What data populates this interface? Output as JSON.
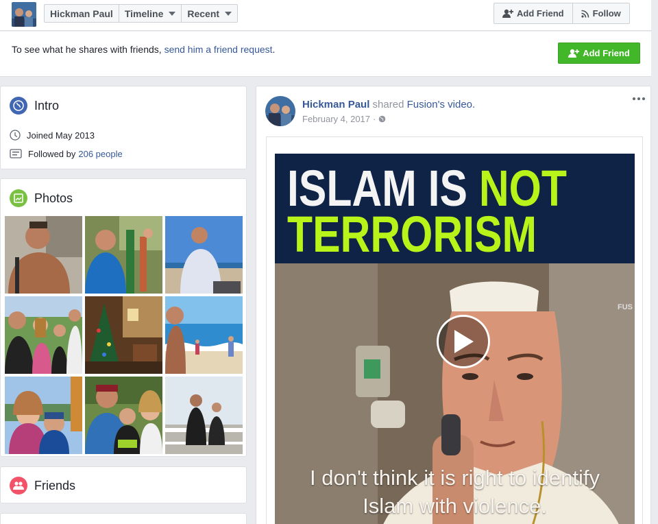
{
  "header": {
    "profile_name": "Hickman Paul",
    "nav_timeline": "Timeline",
    "nav_recent": "Recent",
    "add_friend": "Add Friend",
    "follow": "Follow"
  },
  "request_bar": {
    "text": "To see what he shares with friends,",
    "link": "send him a friend request",
    "link_suffix": ".",
    "button": "Add Friend"
  },
  "intro": {
    "title": "Intro",
    "joined": "Joined May 2013",
    "followed_prefix": "Followed by",
    "followed_count": "206 people"
  },
  "photos": {
    "title": "Photos"
  },
  "friends": {
    "title": "Friends"
  },
  "post": {
    "author": "Hickman Paul",
    "action": "shared",
    "page": "Fusion",
    "object": "'s video.",
    "date": "February 4, 2017",
    "video": {
      "headline_white": "ISLAM IS",
      "headline_green": "NOT",
      "headline_line2": "TERRORISM",
      "caption_line1": "I don't think it is right to identify",
      "caption_line2": "Islam with violence.",
      "brand": "FUS"
    }
  },
  "colors": {
    "link": "#365899",
    "green_button": "#42b72a",
    "headline_green": "#b8f41a",
    "banner_bg": "#0f2347"
  }
}
